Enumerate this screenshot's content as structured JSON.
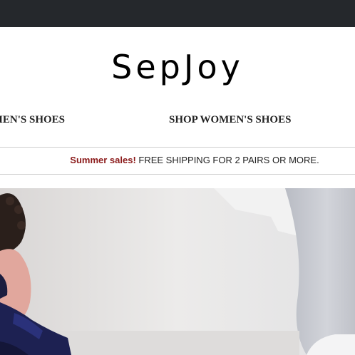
{
  "header": {
    "brand": "SepJoy"
  },
  "nav": {
    "items": [
      {
        "label": "SHOP MEN'S SHOES",
        "visible_label": "MEN'S SHOES"
      },
      {
        "label": "SHOP WOMEN'S SHOES"
      }
    ]
  },
  "promo": {
    "highlight": "Summer sales!",
    "text": " FREE SHIPPING FOR 2 PAIRS OR MORE."
  },
  "colors": {
    "topbar": "#25282c",
    "promo_highlight": "#8b1a1a"
  }
}
